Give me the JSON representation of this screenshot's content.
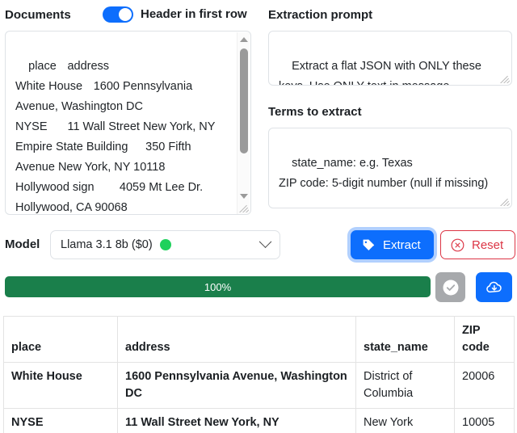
{
  "documents": {
    "label": "Documents",
    "toggle_label": "Header in first row",
    "toggle_on": true,
    "content": "place\taddress\nWhite House\t1600 Pennsylvania Avenue, Washington DC\nNYSE\t11 Wall Street New York, NY\nEmpire State Building\t350 Fifth Avenue New York, NY 10118\nHollywood sign\t4059 Mt Lee Dr. Hollywood, CA 90068"
  },
  "extraction_prompt": {
    "label": "Extraction prompt",
    "value": "Extract a flat JSON with ONLY these keys. Use ONLY text in message"
  },
  "terms": {
    "label": "Terms to extract",
    "value": "state_name: e.g. Texas\nZIP code: 5-digit number (null if missing)"
  },
  "model": {
    "label": "Model",
    "selected": "Llama 3.1 8b ($0)",
    "status_color": "#1fd15c",
    "chevron_icon": "chevron-down-icon"
  },
  "actions": {
    "extract_label": "Extract",
    "extract_icon": "tag-icon",
    "extract_color": "#0d6efd",
    "reset_label": "Reset",
    "reset_icon": "x-circle-icon",
    "reset_color": "#dc3545"
  },
  "progress": {
    "percent_label": "100%",
    "percent_value": 100,
    "fill_color": "#1a7f4b",
    "copy_icon": "check-circle-icon",
    "download_icon": "cloud-download-icon"
  },
  "results": {
    "columns": [
      "place",
      "address",
      "state_name",
      "ZIP code"
    ],
    "rows": [
      {
        "place": "White House",
        "address": "1600 Pennsylvania Avenue, Washington DC",
        "state_name": "District of Columbia",
        "zip_code": "20006"
      },
      {
        "place": "NYSE",
        "address": "11 Wall Street New York, NY",
        "state_name": "New York",
        "zip_code": "10005"
      }
    ]
  }
}
